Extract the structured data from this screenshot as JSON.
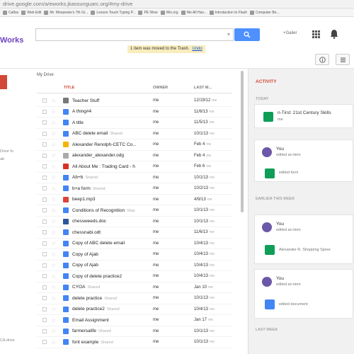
{
  "browser": {
    "url": "drive.google.com/a/eworks.jkassunguarc.org/#my-drive",
    "bookmarks": [
      "Calfus",
      "Web Edit",
      "Mr. Monpeske's 7th Gr...",
      "Lesson Touch Typing P...",
      "PE Wow",
      "Wix.org",
      "We All Hav...",
      "Introduction to Flash",
      "Computer Be..."
    ]
  },
  "header": {
    "brand": "Works",
    "gmail_label": "+Gailer",
    "notice": "1 item was moved to the Trash.",
    "undo_label": "Undo"
  },
  "icons": {
    "search": "search-icon",
    "apps": "apps-grid-icon",
    "notifications": "bell-icon",
    "info": "info-icon",
    "list_view": "list-view-icon"
  },
  "sidebar": {
    "text1": "Drive fo",
    "text2": "ab",
    "footer": "CA drive"
  },
  "drive": {
    "section_label": "My Drive",
    "columns": {
      "title": "TITLE",
      "owner": "OWNER",
      "last": "LAST M..."
    },
    "files": [
      {
        "name": "Teacher Stuff",
        "shared": "",
        "owner": "me",
        "date": "12/19/12",
        "by": "me",
        "type": "folder"
      },
      {
        "name": "A thing#4",
        "shared": "",
        "owner": "me",
        "date": "11/6/13",
        "by": "me",
        "type": "doc"
      },
      {
        "name": "A title",
        "shared": "",
        "owner": "me",
        "date": "11/5/13",
        "by": "me",
        "type": "doc"
      },
      {
        "name": "ABC delete email",
        "shared": "Shared",
        "owner": "me",
        "date": "10/1/13",
        "by": "me",
        "type": "doc"
      },
      {
        "name": "Alexander Renolph-CETC Co...",
        "shared": "",
        "owner": "me",
        "date": "Feb 4",
        "by": "me",
        "type": "ppt"
      },
      {
        "name": "alexander_alexander.odg",
        "shared": "",
        "owner": "me",
        "date": "Feb 4",
        "by": "me",
        "type": "draw"
      },
      {
        "name": "All About Me : Trading Card - h",
        "shared": "",
        "owner": "me",
        "date": "Feb 6",
        "by": "me",
        "type": "pdf"
      },
      {
        "name": "Ab+b",
        "shared": "Shared",
        "owner": "me",
        "date": "10/1/13",
        "by": "me",
        "type": "doc"
      },
      {
        "name": "b+a form",
        "shared": "Shared",
        "owner": "me",
        "date": "10/2/13",
        "by": "me",
        "type": "doc"
      },
      {
        "name": "beep1.mp3",
        "shared": "",
        "owner": "me",
        "date": "4/9/13",
        "by": "me",
        "type": "audio"
      },
      {
        "name": "Conditions of Recognition",
        "shared": "Shar",
        "owner": "me",
        "date": "10/1/13",
        "by": "me",
        "type": "doc"
      },
      {
        "name": "chessweeds.doc",
        "shared": "",
        "owner": "me",
        "date": "10/1/13",
        "by": "me",
        "type": "word"
      },
      {
        "name": "chessnabi.odt",
        "shared": "",
        "owner": "me",
        "date": "11/6/13",
        "by": "me",
        "type": "doc"
      },
      {
        "name": "Copy of ABC delete email",
        "shared": "",
        "owner": "me",
        "date": "10/4/13",
        "by": "me",
        "type": "doc"
      },
      {
        "name": "Copy of Ajab",
        "shared": "",
        "owner": "me",
        "date": "10/4/13",
        "by": "me",
        "type": "doc"
      },
      {
        "name": "Copy of Ajab",
        "shared": "",
        "owner": "me",
        "date": "10/4/13",
        "by": "me",
        "type": "doc"
      },
      {
        "name": "Copy of delete practice2",
        "shared": "",
        "owner": "me",
        "date": "10/4/13",
        "by": "me",
        "type": "doc"
      },
      {
        "name": "CYOA",
        "shared": "Shared",
        "owner": "me",
        "date": "Jan 10",
        "by": "me",
        "type": "doc"
      },
      {
        "name": "delete practice",
        "shared": "Shared",
        "owner": "me",
        "date": "10/1/13",
        "by": "me",
        "type": "doc"
      },
      {
        "name": "delete practice2",
        "shared": "Shared",
        "owner": "me",
        "date": "10/4/13",
        "by": "me",
        "type": "doc"
      },
      {
        "name": "Email Assignment",
        "shared": "",
        "owner": "me",
        "date": "Jan 17",
        "by": "me",
        "type": "doc"
      },
      {
        "name": "farmersalife",
        "shared": "Shared",
        "owner": "me",
        "date": "10/1/13",
        "by": "me",
        "type": "doc"
      },
      {
        "name": "font example",
        "shared": "Shared",
        "owner": "me",
        "date": "10/1/13",
        "by": "me",
        "type": "doc"
      }
    ]
  },
  "activity": {
    "title": "ACTIVITY",
    "today_label": "TODAY",
    "earlier_label": "EARLIER THIS WEEK",
    "last_week_label": "LAST WEEK",
    "items": [
      {
        "who": "",
        "text": "n-Tirst: 21st Century Skills",
        "sub": "me"
      },
      {
        "who": "You",
        "text": "edited an item",
        "sub": "edited form"
      },
      {
        "who": "You",
        "text": "edited an item",
        "sub": "Alexander R. Shopping Spree"
      },
      {
        "who": "You",
        "text": "edited an item",
        "sub": "edited document"
      }
    ]
  },
  "colors": {
    "accent_blue": "#4d90fe",
    "accent_red": "#d14836",
    "brand_purple": "#6f42c1"
  }
}
